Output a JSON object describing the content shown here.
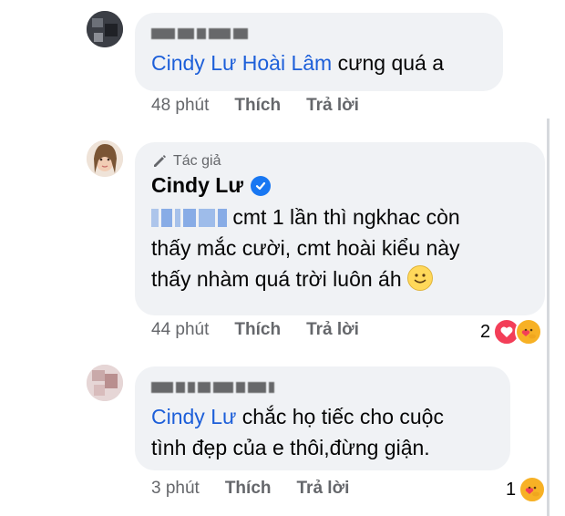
{
  "comments": [
    {
      "author_obscured": true,
      "mention": "Cindy Lư Hoài Lâm",
      "text": " cưng quá a",
      "time": "48 phút",
      "like_label": "Thích",
      "reply_label": "Trả lời"
    },
    {
      "author_badge": "Tác giả",
      "author": "Cindy Lư",
      "verified_icon": "verified-check-icon",
      "mention_obscured": true,
      "text_line1": "cmt 1 lần thì ngkhac còn",
      "text_line2": "thấy mắc cười, cmt hoài kiểu này",
      "text_line3": "thấy nhàm quá trời luôn áh",
      "emoji": "slightly-smiling-face",
      "time": "44 phút",
      "like_label": "Thích",
      "reply_label": "Trả lời",
      "reaction_count": "2",
      "reactions": [
        "love-reaction",
        "care-reaction"
      ]
    },
    {
      "author_obscured": true,
      "mention": "Cindy Lư",
      "text_line1": " chắc họ tiếc cho cuộc",
      "text_line2": "tình đẹp của e thôi,đừng giận.",
      "time": "3 phút",
      "like_label": "Thích",
      "reply_label": "Trả lời",
      "reaction_count": "1",
      "reactions": [
        "care-reaction"
      ]
    }
  ],
  "colors": {
    "bubble": "#f0f2f5",
    "mention": "#1d5fd9",
    "meta": "#65676b",
    "love": "#f33e58",
    "verified": "#1877f2"
  }
}
